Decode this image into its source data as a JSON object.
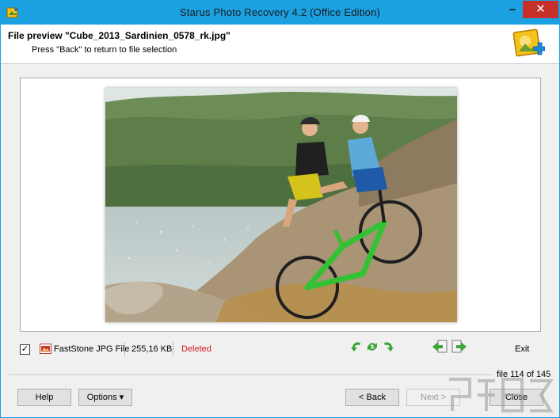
{
  "window": {
    "title": "Starus Photo Recovery 4.2 (Office Edition)",
    "min_glyph": "–",
    "close_glyph": "✕"
  },
  "header": {
    "title": "File preview \"Cube_2013_Sardinien_0578_rk.jpg\"",
    "subtitle": "Press \"Back\" to return to file selection"
  },
  "file_info": {
    "checked_glyph": "✓",
    "type": "FastStone JPG File",
    "size": "255,16 KB",
    "status": "Deleted",
    "status_color": "#d01c1c"
  },
  "toolbar": {
    "icons": [
      "rotate-left-icon",
      "flip-icon",
      "rotate-right-icon",
      "previous-file-icon",
      "next-file-icon"
    ],
    "exit_label": "Exit"
  },
  "counter": "file 114 of 145",
  "buttons": {
    "help": "Help",
    "options": "Options ▾",
    "back": "< Back",
    "next": "Next >",
    "close": "Close"
  },
  "colors": {
    "titlebar": "#1ba1e2",
    "close_button": "#c7302a",
    "arrow_green": "#3aa635"
  }
}
